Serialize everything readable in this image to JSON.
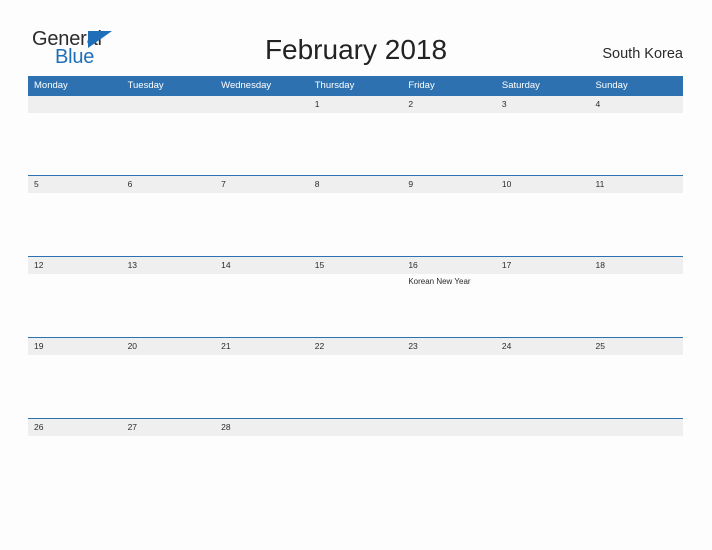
{
  "brand": {
    "name_part1": "General",
    "name_part2": "Blue",
    "triangle_color": "#1f6fb8"
  },
  "header": {
    "title": "February 2018",
    "region": "South Korea"
  },
  "theme": {
    "header_blue": "#2d71b0",
    "band_gray": "#efeff0",
    "text_dark": "#2b2b2b",
    "page_background": "#fdfdfd"
  },
  "calendar": {
    "weekdays": [
      "Monday",
      "Tuesday",
      "Wednesday",
      "Thursday",
      "Friday",
      "Saturday",
      "Sunday"
    ],
    "weeks": [
      {
        "days": [
          {
            "date": "",
            "event": ""
          },
          {
            "date": "",
            "event": ""
          },
          {
            "date": "",
            "event": ""
          },
          {
            "date": "1",
            "event": ""
          },
          {
            "date": "2",
            "event": ""
          },
          {
            "date": "3",
            "event": ""
          },
          {
            "date": "4",
            "event": ""
          }
        ]
      },
      {
        "days": [
          {
            "date": "5",
            "event": ""
          },
          {
            "date": "6",
            "event": ""
          },
          {
            "date": "7",
            "event": ""
          },
          {
            "date": "8",
            "event": ""
          },
          {
            "date": "9",
            "event": ""
          },
          {
            "date": "10",
            "event": ""
          },
          {
            "date": "11",
            "event": ""
          }
        ]
      },
      {
        "days": [
          {
            "date": "12",
            "event": ""
          },
          {
            "date": "13",
            "event": ""
          },
          {
            "date": "14",
            "event": ""
          },
          {
            "date": "15",
            "event": ""
          },
          {
            "date": "16",
            "event": "Korean New Year"
          },
          {
            "date": "17",
            "event": ""
          },
          {
            "date": "18",
            "event": ""
          }
        ]
      },
      {
        "days": [
          {
            "date": "19",
            "event": ""
          },
          {
            "date": "20",
            "event": ""
          },
          {
            "date": "21",
            "event": ""
          },
          {
            "date": "22",
            "event": ""
          },
          {
            "date": "23",
            "event": ""
          },
          {
            "date": "24",
            "event": ""
          },
          {
            "date": "25",
            "event": ""
          }
        ]
      },
      {
        "days": [
          {
            "date": "26",
            "event": ""
          },
          {
            "date": "27",
            "event": ""
          },
          {
            "date": "28",
            "event": ""
          },
          {
            "date": "",
            "event": ""
          },
          {
            "date": "",
            "event": ""
          },
          {
            "date": "",
            "event": ""
          },
          {
            "date": "",
            "event": ""
          }
        ]
      }
    ]
  }
}
